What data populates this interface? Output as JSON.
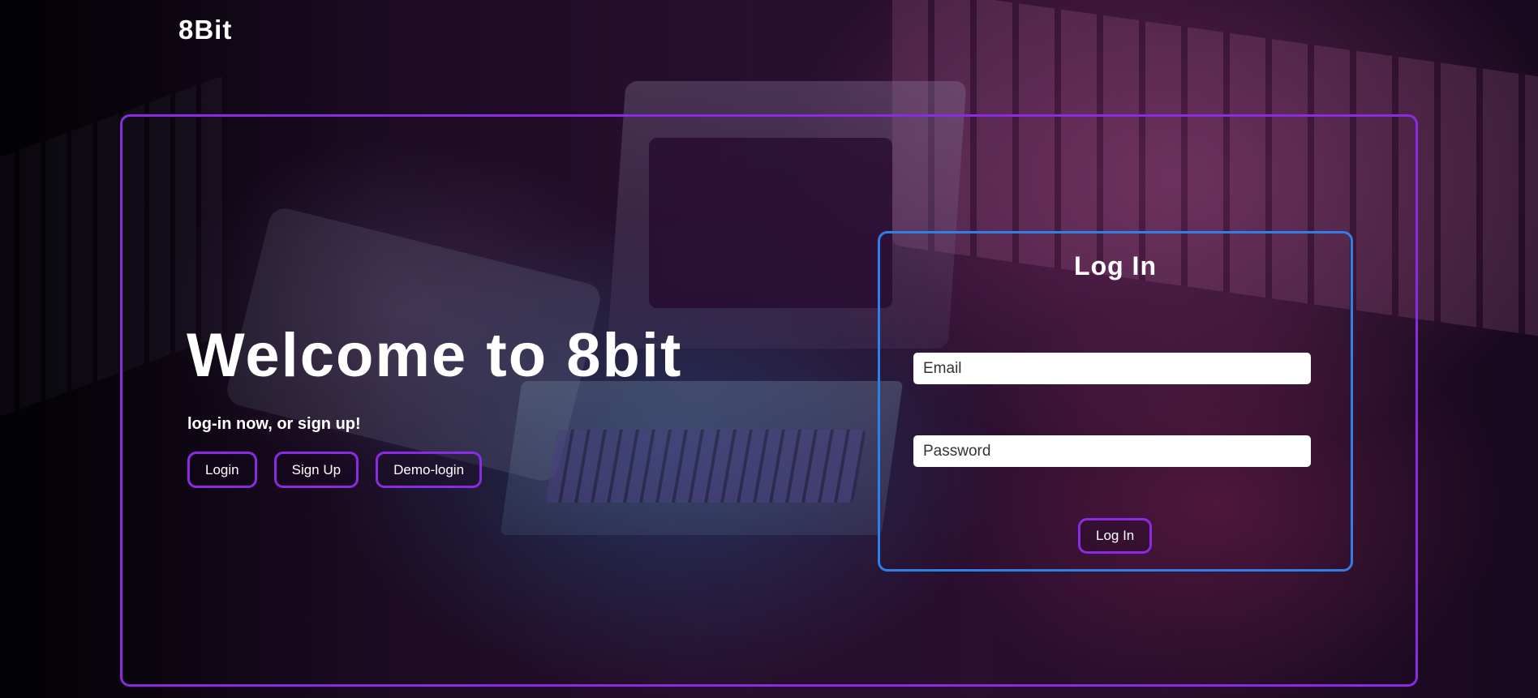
{
  "app": {
    "logo": "8Bit"
  },
  "hero": {
    "title": "Welcome to 8bit",
    "tagline": "log-in now, or sign up!",
    "buttons": {
      "login": "Login",
      "signup": "Sign Up",
      "demo": "Demo-login"
    }
  },
  "login_form": {
    "title": "Log In",
    "email_placeholder": "Email",
    "password_placeholder": "Password",
    "submit_label": "Log In"
  },
  "colors": {
    "frame_accent": "#8a2be2",
    "card_border": "#2f7fe6",
    "text": "#ffffff"
  }
}
